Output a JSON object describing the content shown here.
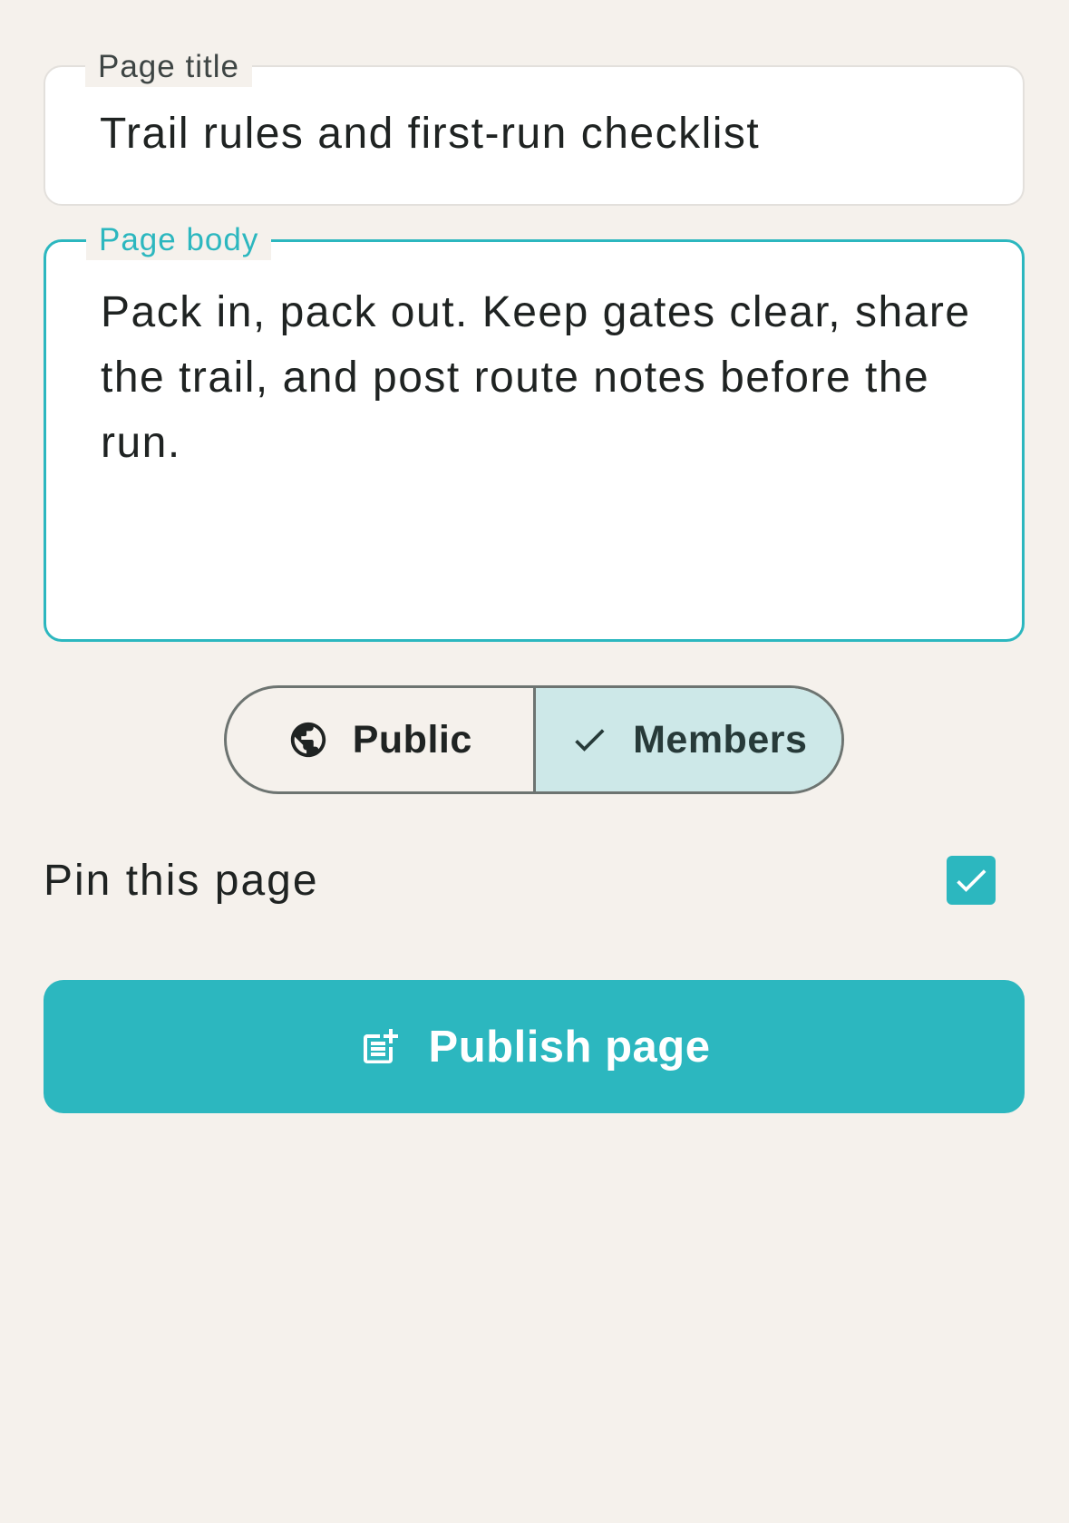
{
  "form": {
    "title_field": {
      "label": "Page title",
      "value": "Trail rules and first-run checklist"
    },
    "body_field": {
      "label": "Page body",
      "value": "Pack in, pack out. Keep gates clear, share the trail, and post route notes before the run."
    }
  },
  "visibility": {
    "options": [
      {
        "label": "Public",
        "icon": "globe-icon",
        "selected": false
      },
      {
        "label": "Members",
        "icon": "check-icon",
        "selected": true
      }
    ]
  },
  "pin": {
    "label": "Pin this page",
    "checked": true
  },
  "publish": {
    "label": "Publish page",
    "icon": "post-add-icon"
  },
  "colors": {
    "accent": "#2cb7bf",
    "background": "#f5f1ec",
    "selected_segment": "#cde8e8"
  }
}
